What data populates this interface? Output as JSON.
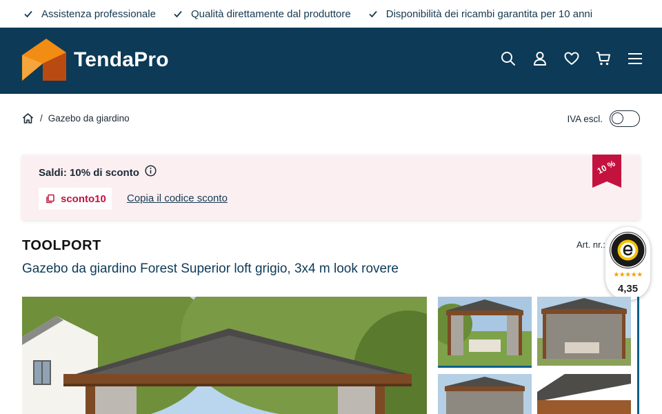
{
  "usp": [
    {
      "label": "Assistenza professionale"
    },
    {
      "label": "Qualità direttamente dal produttore"
    },
    {
      "label": "Disponibilità dei ricambi garantita per 10 anni"
    }
  ],
  "header": {
    "brand_name": "TendaPro",
    "icons": [
      "search-icon",
      "user-icon",
      "heart-icon",
      "cart-icon",
      "menu-icon"
    ],
    "background": "#0c3a57",
    "logo_orange": "#f28c13"
  },
  "breadcrumb": {
    "items": [
      "Gazebo da giardino"
    ]
  },
  "vat": {
    "label": "IVA escl.",
    "enabled": false
  },
  "promo": {
    "title": "Saldi: 10% di sconto",
    "code": "sconto10",
    "copy_label": "Copia il codice sconto",
    "ribbon": "10 %",
    "accent": "#c4123f"
  },
  "product": {
    "brand": "TOOLPORT",
    "art_nr_label": "Art. nr.:",
    "title": "Gazebo da giardino Forest Superior loft grigio, 3x4 m look rovere"
  },
  "trusted_shops": {
    "stars": "★★★★★",
    "score": "4,35"
  }
}
